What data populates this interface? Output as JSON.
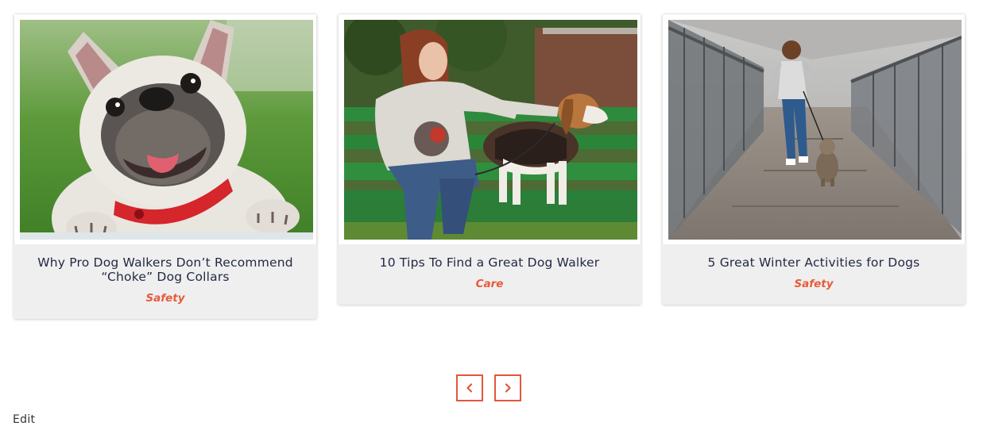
{
  "posts": [
    {
      "title": "Why Pro Dog Walkers Don’t Recommend “Choke” Dog Collars",
      "category": "Safety",
      "image_alt": "French bulldog with red collar smiling"
    },
    {
      "title": "10 Tips To Find a Great Dog Walker",
      "category": "Care",
      "image_alt": "Woman on green park bench petting a beagle on a leash"
    },
    {
      "title": "5 Great Winter Activities for Dogs",
      "category": "Safety",
      "image_alt": "Child running with small terrier across a fenced footbridge"
    }
  ],
  "carousel": {
    "prev_icon": "chevron-left-icon",
    "next_icon": "chevron-right-icon"
  },
  "footer": {
    "edit_label": "Edit"
  },
  "colors": {
    "accent": "#e2583a",
    "title": "#232a44",
    "card_bg": "#efefef"
  }
}
